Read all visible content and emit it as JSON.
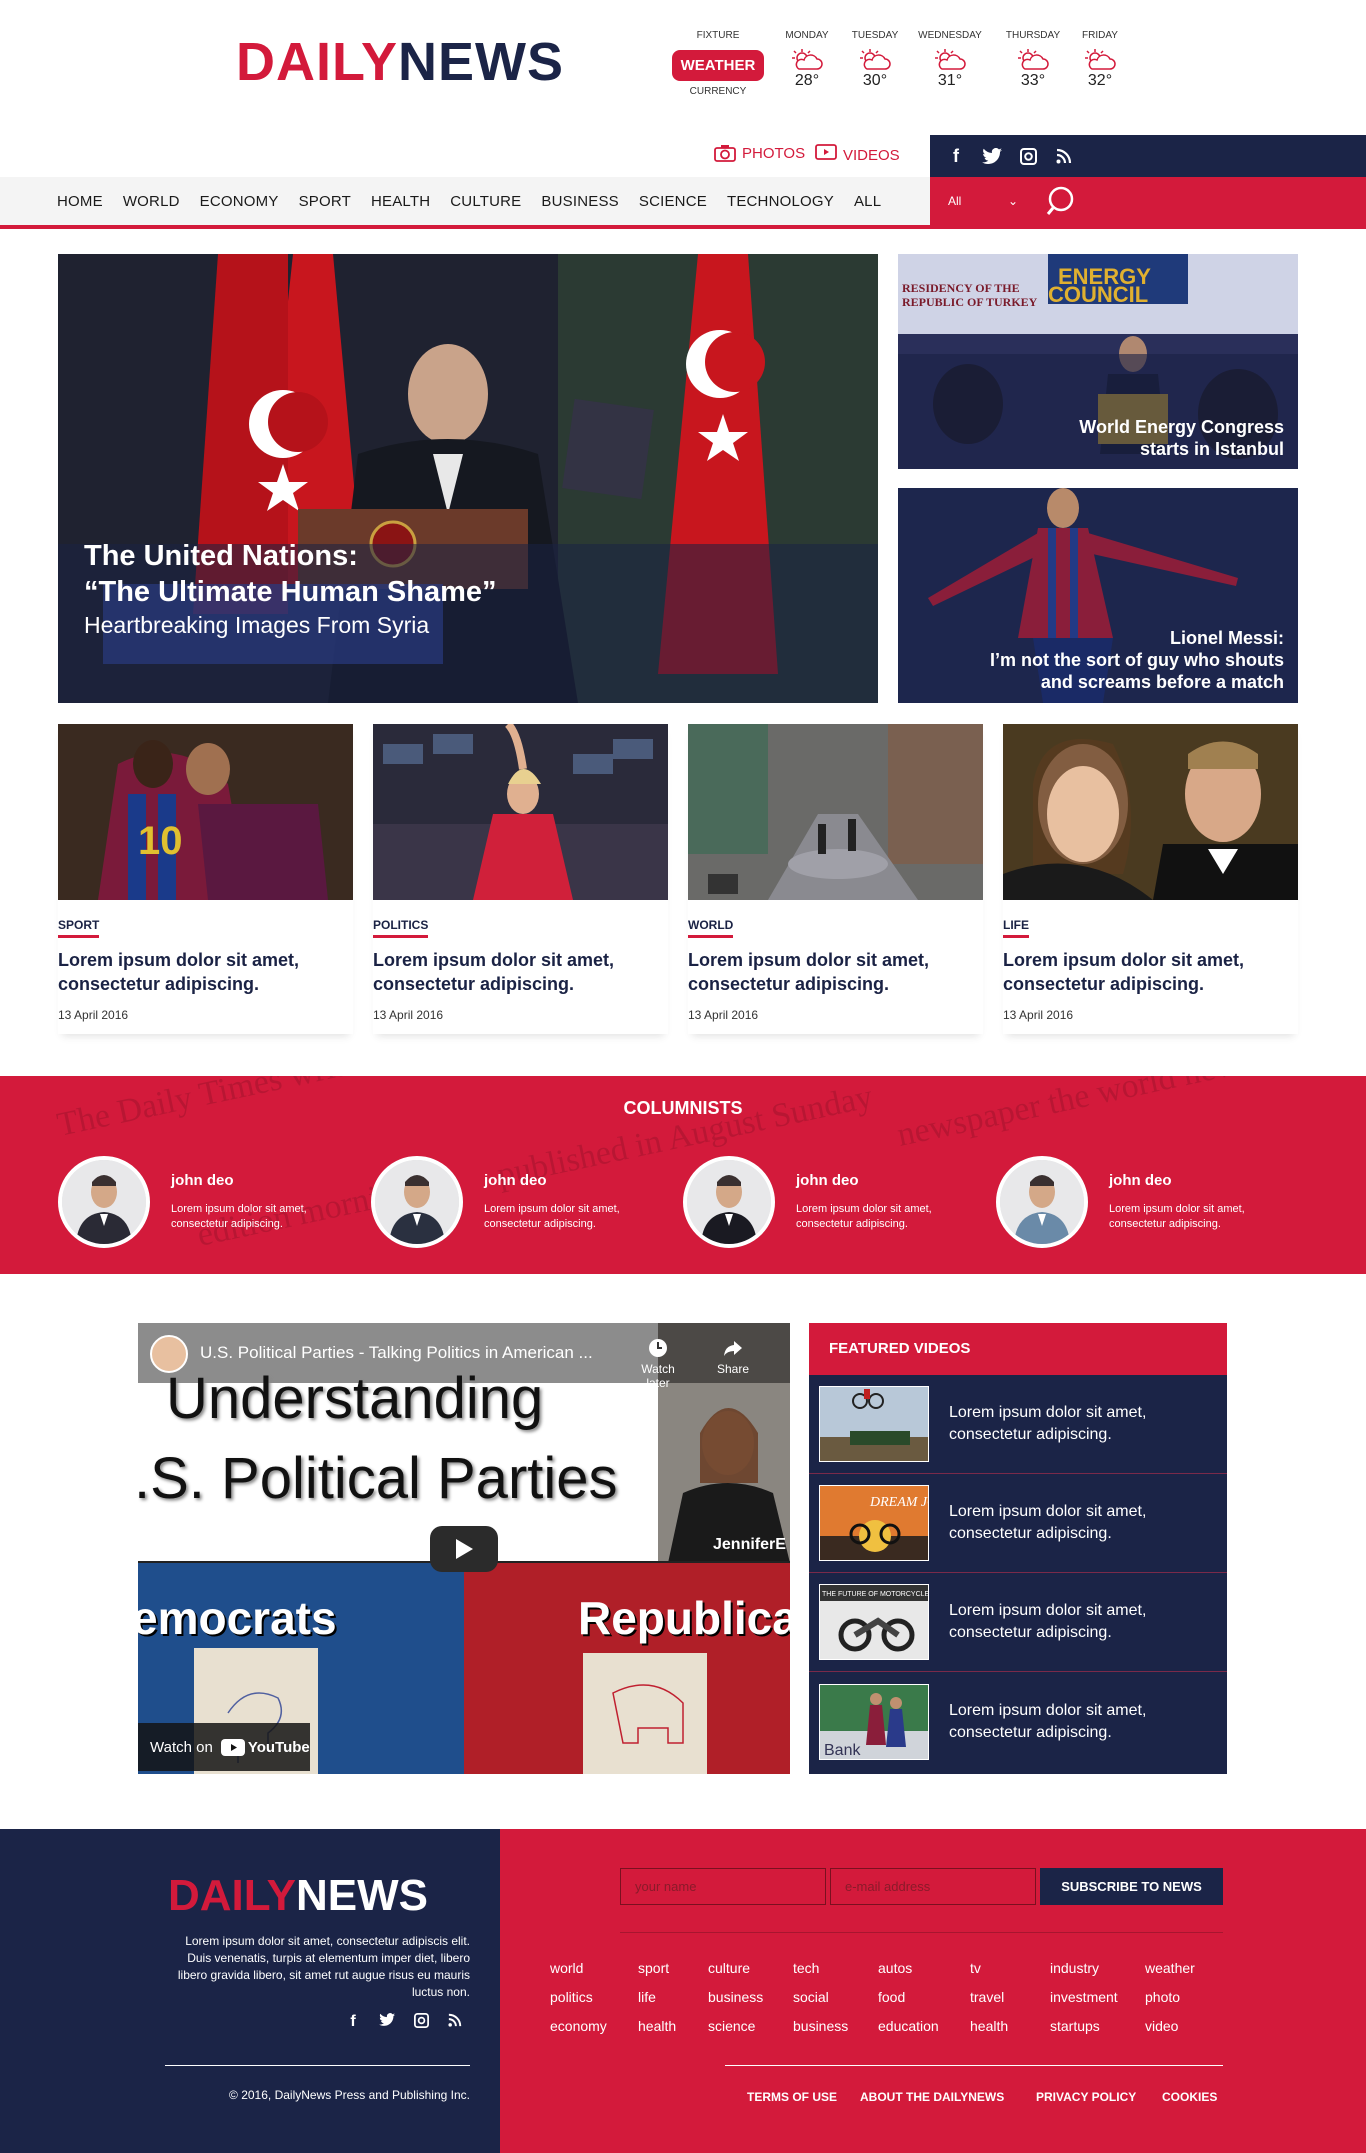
{
  "brand": {
    "logo_a": "DAILY",
    "logo_b": "NEWS"
  },
  "weather": {
    "fixture": "FIXTURE",
    "button": "WEATHER",
    "currency": "CURRENCY",
    "days": [
      {
        "name": "MONDAY",
        "temp": "28°"
      },
      {
        "name": "TUESDAY",
        "temp": "30°"
      },
      {
        "name": "WEDNESDAY",
        "temp": "31°"
      },
      {
        "name": "THURSDAY",
        "temp": "33°"
      },
      {
        "name": "FRIDAY",
        "temp": "32°"
      }
    ]
  },
  "media": {
    "photos": "PHOTOS",
    "videos": "VIDEOS"
  },
  "social": [
    "facebook-icon",
    "twitter-icon",
    "instagram-icon",
    "rss-icon"
  ],
  "nav": [
    "HOME",
    "WORLD",
    "ECONOMY",
    "SPORT",
    "HEALTH",
    "CULTURE",
    "BUSINESS",
    "SCIENCE",
    "TECHNOLOGY",
    "ALL"
  ],
  "search": {
    "filter": "All"
  },
  "hero": {
    "line1": "The United Nations:",
    "line2": "“The Ultimate Human Shame”",
    "line3": "Heartbreaking Images From Syria"
  },
  "side_stories": [
    {
      "line1": "World Energy Congress",
      "line2": "starts in Istanbul"
    },
    {
      "line1": "Lionel Messi:",
      "line2": "I’m not the sort of guy who shouts",
      "line3": "and screams before a match"
    }
  ],
  "cards": [
    {
      "category": "SPORT",
      "title": "Lorem ipsum dolor sit amet, consectetur adipiscing.",
      "date": "13 April 2016"
    },
    {
      "category": "POLITICS",
      "title": "Lorem ipsum dolor sit amet, consectetur adipiscing.",
      "date": "13 April 2016"
    },
    {
      "category": "WORLD",
      "title": "Lorem ipsum dolor sit amet, consectetur adipiscing.",
      "date": "13 April 2016"
    },
    {
      "category": "LIFE",
      "title": "Lorem ipsum dolor sit amet, consectetur adipiscing.",
      "date": "13 April 2016"
    }
  ],
  "columnists": {
    "title": "COLUMNISTS",
    "items": [
      {
        "name": "john deo",
        "text": "Lorem ipsum dolor sit amet, consectetur adipiscing."
      },
      {
        "name": "john deo",
        "text": "Lorem ipsum dolor sit amet, consectetur adipiscing."
      },
      {
        "name": "john deo",
        "text": "Lorem ipsum dolor sit amet, consectetur adipiscing."
      },
      {
        "name": "john deo",
        "text": "Lorem ipsum dolor sit amet, consectetur adipiscing."
      }
    ]
  },
  "video": {
    "title": "U.S. Political Parties - Talking Politics in American ...",
    "watch_later": "Watch later",
    "share": "Share",
    "line1": "Understanding",
    "line2": ".S. Political Parties",
    "left": "emocrats",
    "right": "Republica",
    "badge": "JenniferE",
    "watch_on": "Watch on",
    "youtube": "YouTube"
  },
  "featured_videos": {
    "title": "FEATURED VIDEOS",
    "items": [
      {
        "text": "Lorem ipsum dolor sit amet, consectetur adipiscing."
      },
      {
        "text": "Lorem ipsum dolor sit amet, consectetur adipiscing."
      },
      {
        "text": "Lorem ipsum dolor sit amet, consectetur adipiscing."
      },
      {
        "text": "Lorem ipsum dolor sit amet, consectetur adipiscing."
      }
    ],
    "thumb2": "DREAM JOB",
    "thumb3": "THE FUTURE OF MOTORCYCLES",
    "thumb4": "Bank"
  },
  "footer": {
    "desc": "Lorem ipsum dolor sit amet, consectetur adipiscis elit. Duis venenatis, turpis at elementum imper diet, libero libero gravida libero, sit amet rut augue risus eu mauris luctus non.",
    "copyright": "© 2016, DailyNews Press and Publishing Inc.",
    "name_placeholder": "your name",
    "email_placeholder": "e-mail address",
    "subscribe": "SUBSCRIBE TO NEWS",
    "links": [
      "world",
      "sport",
      "culture",
      "tech",
      "autos",
      "tv",
      "industry",
      "weather",
      "politics",
      "life",
      "business",
      "social",
      "food",
      "travel",
      "investment",
      "photo",
      "economy",
      "health",
      "science",
      "business",
      "education",
      "health",
      "startups",
      "video"
    ],
    "bottom": [
      "TERMS OF USE",
      "ABOUT THE DAILYNEWS",
      "PRIVACY POLICY",
      "COOKIES"
    ]
  },
  "colors": {
    "red": "#d31a3b",
    "navy": "#1b2447"
  }
}
